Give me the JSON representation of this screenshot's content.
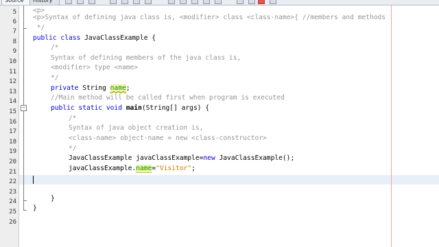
{
  "tabs": {
    "source": "Source",
    "history": "History"
  },
  "line_numbers": [
    "5",
    "6",
    "7",
    "8",
    "9",
    "10",
    "11",
    "12",
    "13",
    "14",
    "15",
    "16",
    "17",
    "18",
    "19",
    "20",
    "21",
    "22",
    "23",
    "24",
    "25",
    "26"
  ],
  "fold_glyph": "−",
  "code": {
    "l5": "<p>",
    "l6": "<p>Syntax of defining java class is, <modifier> class <class-name>{ //members and methods",
    "l7": " */",
    "l8_kw": "public class",
    "l8_rest": " JavaClassExample {",
    "l9": "/*",
    "l10": "Syntax of defining members of the java class is,",
    "l11": "<modifier> type <name>",
    "l12": "*/",
    "l13_kw": "private",
    "l13_type": " String ",
    "l13_field": "name",
    "l13_end": ";",
    "l14": "//Main method will be called first when program is executed",
    "l15_kw": "public static void",
    "l15_method": " main",
    "l15_rest": "(String[] args) {",
    "l16": "/*",
    "l17": "Syntax of java object creation is,",
    "l18": "<class-name> object-name = new <class-constructor>",
    "l19": "*/",
    "l20_a": "JavaClassExample javaClassExample=",
    "l20_kw": "new",
    "l20_b": " JavaClassExample();",
    "l21_a": "javaClassExample.",
    "l21_field": "name",
    "l21_eq": "=",
    "l21_str": "\"Visitor\"",
    "l21_end": ";",
    "l24": "}",
    "l26": "}"
  }
}
